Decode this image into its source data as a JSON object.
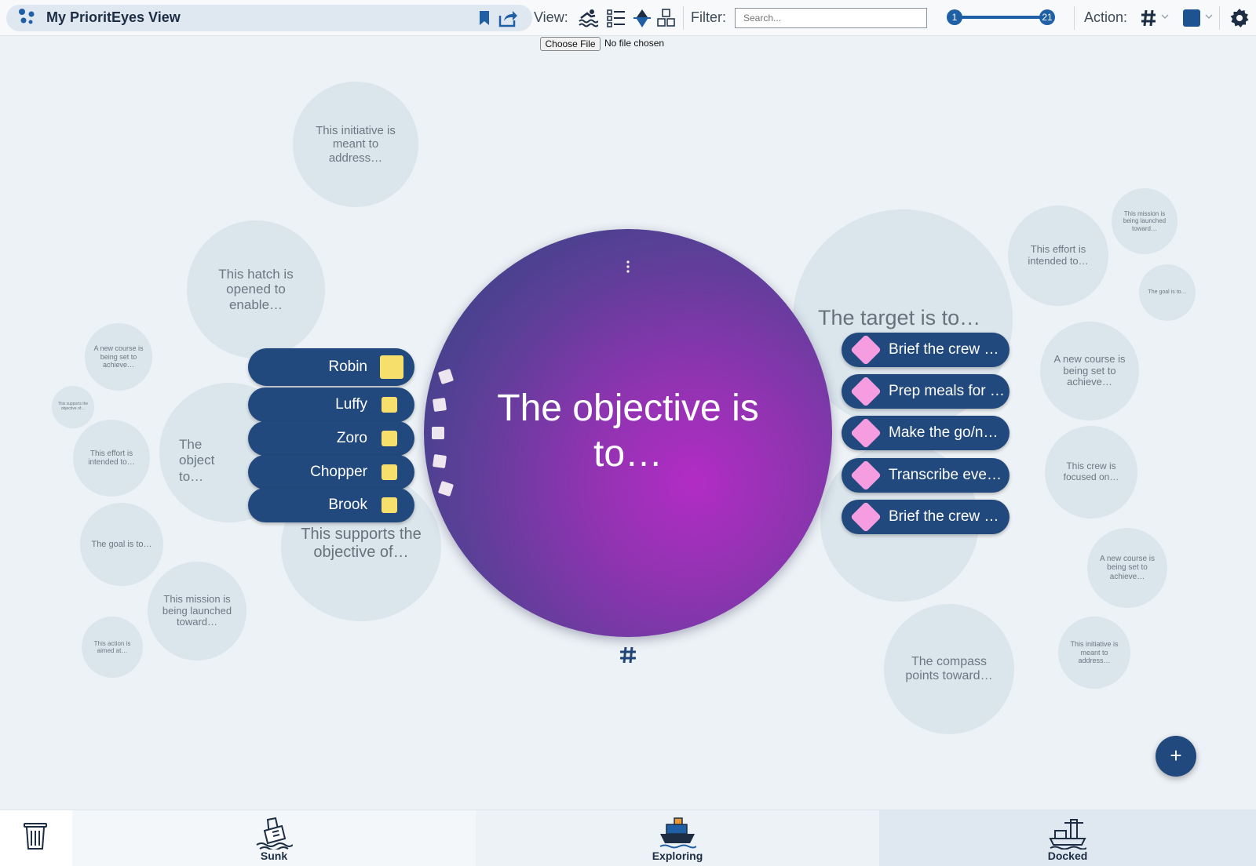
{
  "header": {
    "title": "My PrioritEyes View",
    "view_label": "View:",
    "filter_label": "Filter:",
    "search_placeholder": "Search...",
    "range_min": "1",
    "range_max": "21",
    "action_label": "Action:",
    "accent_color": "#1f5fa5",
    "colour_swatch": "#1e5391"
  },
  "file_input": {
    "button_label": "Choose File",
    "status": "No file chosen"
  },
  "center": {
    "text": "The objective is to…"
  },
  "team": [
    {
      "name": "Robin"
    },
    {
      "name": "Luffy"
    },
    {
      "name": "Zoro"
    },
    {
      "name": "Chopper"
    },
    {
      "name": "Brook"
    }
  ],
  "tasks": [
    {
      "label": "Brief the crew …"
    },
    {
      "label": "Prep meals for …"
    },
    {
      "label": "Make the go/n…"
    },
    {
      "label": "Transcribe eve…"
    },
    {
      "label": "Brief the crew …"
    }
  ],
  "labels": {
    "target": "The target is to…",
    "supports": "This supports the objective of…",
    "object_partial": "The object to…"
  },
  "bubbles": [
    {
      "text": "This initiative is meant to address…"
    },
    {
      "text": "This hatch is opened to enable…"
    },
    {
      "text": "A new course is being set to achieve…"
    },
    {
      "text": "This supports the objective of…"
    },
    {
      "text": "This effort is intended to…"
    },
    {
      "text": "The goal is to…"
    },
    {
      "text": "This mission is being launched toward…"
    },
    {
      "text": "This action is aimed at…"
    },
    {
      "text": "This effort is intended to…"
    },
    {
      "text": "This mission is being launched toward…"
    },
    {
      "text": "The goal is to…"
    },
    {
      "text": "A new course is being set to achieve…"
    },
    {
      "text": "This crew is focused on…"
    },
    {
      "text": "A new course is being set to achieve…"
    },
    {
      "text": "This initiative is meant to address…"
    },
    {
      "text": "The compass points toward…"
    }
  ],
  "fab_label": "+",
  "bottom_tabs": [
    {
      "label": "Sunk",
      "icon": "sinking-ship-icon"
    },
    {
      "label": "Exploring",
      "icon": "ship-icon"
    },
    {
      "label": "Docked",
      "icon": "dock-icon"
    }
  ]
}
